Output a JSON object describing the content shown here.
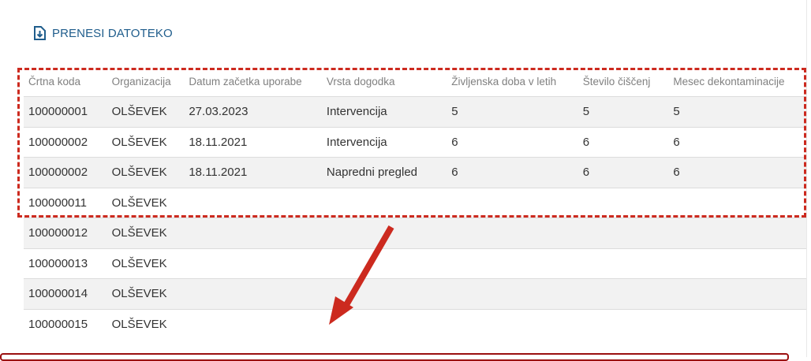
{
  "toolbar": {
    "download_label": "PRENESI DATOTEKO",
    "download_icon": "file-download-icon"
  },
  "table": {
    "columns": [
      "Črtna koda",
      "Organizacija",
      "Datum začetka uporabe",
      "Vrsta dogodka",
      "Življenska doba v letih",
      "Število čiščenj",
      "Mesec dekontaminacije"
    ],
    "rows": [
      {
        "code": "100000001",
        "org": "OLŠEVEK",
        "date": "27.03.2023",
        "type": "Intervencija",
        "life": "5",
        "cleanings": "5",
        "month": "5"
      },
      {
        "code": "100000002",
        "org": "OLŠEVEK",
        "date": "18.11.2021",
        "type": "Intervencija",
        "life": "6",
        "cleanings": "6",
        "month": "6"
      },
      {
        "code": "100000002",
        "org": "OLŠEVEK",
        "date": "18.11.2021",
        "type": "Napredni pregled",
        "life": "6",
        "cleanings": "6",
        "month": "6"
      },
      {
        "code": "100000011",
        "org": "OLŠEVEK",
        "date": "",
        "type": "",
        "life": "",
        "cleanings": "",
        "month": ""
      },
      {
        "code": "100000012",
        "org": "OLŠEVEK",
        "date": "",
        "type": "",
        "life": "",
        "cleanings": "",
        "month": ""
      },
      {
        "code": "100000013",
        "org": "OLŠEVEK",
        "date": "",
        "type": "",
        "life": "",
        "cleanings": "",
        "month": ""
      },
      {
        "code": "100000014",
        "org": "OLŠEVEK",
        "date": "",
        "type": "",
        "life": "",
        "cleanings": "",
        "month": ""
      },
      {
        "code": "100000015",
        "org": "OLŠEVEK",
        "date": "",
        "type": "",
        "life": "",
        "cleanings": "",
        "month": ""
      }
    ]
  },
  "annotations": {
    "highlight_color": "#cc2a1f",
    "arrow_color": "#cc2a1f"
  }
}
